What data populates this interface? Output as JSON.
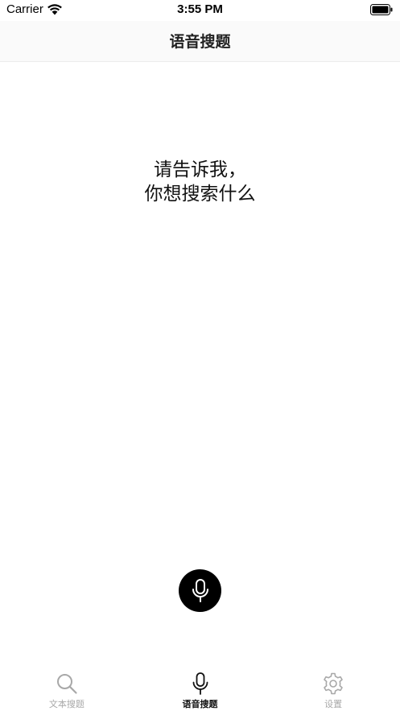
{
  "status_bar": {
    "carrier": "Carrier",
    "time": "3:55 PM"
  },
  "nav": {
    "title": "语音搜题"
  },
  "prompt": {
    "line1": "请告诉我，",
    "line2": "你想搜索什么"
  },
  "mic_button": {
    "icon": "microphone-icon"
  },
  "tabs": [
    {
      "label": "文本搜题",
      "icon": "search-icon",
      "active": false
    },
    {
      "label": "语音搜题",
      "icon": "microphone-icon",
      "active": true
    },
    {
      "label": "设置",
      "icon": "gear-icon",
      "active": false
    }
  ],
  "colors": {
    "active_tab": "#111111",
    "inactive_tab": "#a8a8a8",
    "mic_bg": "#000000"
  }
}
